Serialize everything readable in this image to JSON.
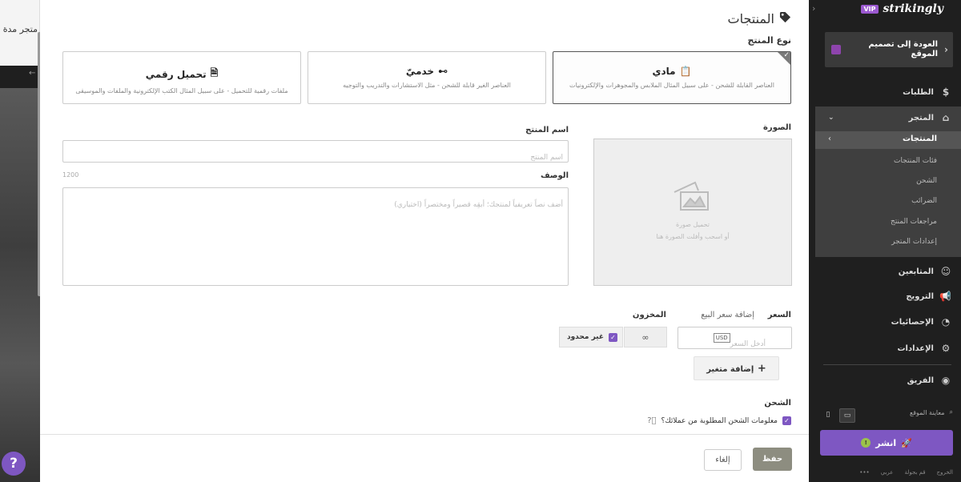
{
  "background_page": {
    "top_nav": "متجر  مدة",
    "strip": "←"
  },
  "help_button": "?",
  "modal": {
    "title": "المنتجات",
    "product_type_label": "نوع المنتج",
    "product_types": [
      {
        "title": "مادي",
        "desc": "العناصر القابلة للشحن - على سبيل المثال الملابس والمجوهرات والإلكترونيات",
        "selected": true
      },
      {
        "title": "خدميّ",
        "desc": "العناصر الغير قابلة للشحن - مثل الاستشارات والتدريب والتوجيه",
        "selected": false
      },
      {
        "title": "تحميل رقمي",
        "desc": "ملفات رقمية للتحميل - على سبيل المثال الكتب الإلكترونية والملفات والموسيقى",
        "selected": false
      }
    ],
    "image_label": "الصورة",
    "image_hint_1": "تحميل صورة",
    "image_hint_2": "أو اسحب وأفلت الصورة هنا",
    "name_label": "اسم المنتج",
    "name_placeholder": "اسم المنتج",
    "desc_label": "الوصف",
    "desc_placeholder": "أضف نصاً تعريفياً لمنتجك؛ أبقِه قصيراً ومختصراً (اختياري)",
    "desc_counter": "1200",
    "price_label": "السعر",
    "add_sale_price": "إضافة سعر البيع",
    "price_placeholder": "أدخل السعر",
    "currency": "USD",
    "inventory_label": "المخزون",
    "inventory_value": "∞",
    "unlimited_label": "غير محدود",
    "add_variant": "إضافة متغير",
    "shipping_label": "الشحن",
    "shipping_question": "معلومات الشحن المطلوبة من عملائك؟",
    "save": "حفظ",
    "cancel": "إلغاء"
  },
  "sidebar": {
    "brand": "strikingly",
    "vip": "VIP",
    "back": "العودة إلى تصميم الموقع",
    "items": {
      "orders": "الطلبات",
      "store": "المتجر",
      "followers": "المتابعين",
      "promotion": "الترويج",
      "stats": "الإحصائيات",
      "settings": "الإعدادات",
      "team": "الفريق"
    },
    "store_sub": [
      "المنتجات",
      "فئات المنتجات",
      "الشحن",
      "الضرائب",
      "مراجعات المنتج",
      "إعدادات المتجر"
    ],
    "preview": "معاينة الموقع",
    "publish": "انشر",
    "footer": [
      "الخروج",
      "قم بجولة",
      "عربي",
      "•••"
    ]
  }
}
